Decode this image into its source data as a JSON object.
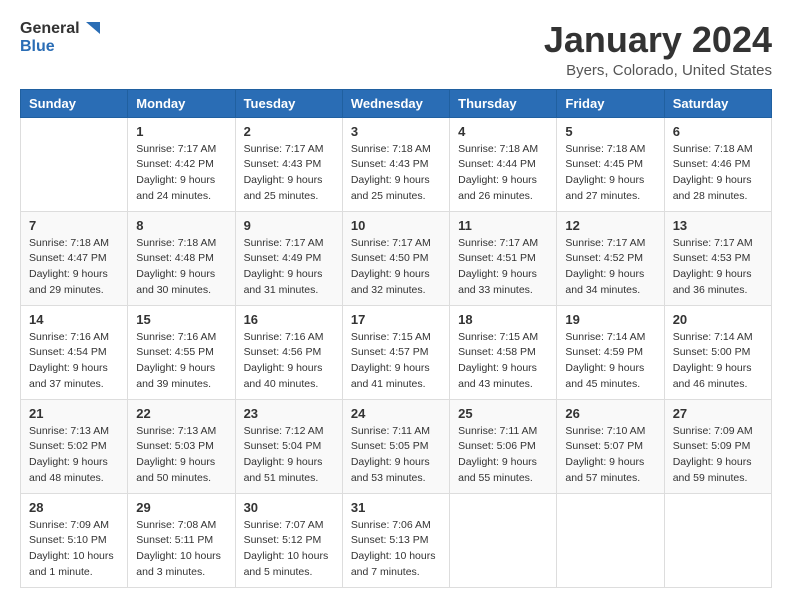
{
  "logo": {
    "general": "General",
    "blue": "Blue"
  },
  "header": {
    "month": "January 2024",
    "location": "Byers, Colorado, United States"
  },
  "weekdays": [
    "Sunday",
    "Monday",
    "Tuesday",
    "Wednesday",
    "Thursday",
    "Friday",
    "Saturday"
  ],
  "weeks": [
    [
      {
        "day": null
      },
      {
        "day": "1",
        "sunrise": "Sunrise: 7:17 AM",
        "sunset": "Sunset: 4:42 PM",
        "daylight": "Daylight: 9 hours and 24 minutes."
      },
      {
        "day": "2",
        "sunrise": "Sunrise: 7:17 AM",
        "sunset": "Sunset: 4:43 PM",
        "daylight": "Daylight: 9 hours and 25 minutes."
      },
      {
        "day": "3",
        "sunrise": "Sunrise: 7:18 AM",
        "sunset": "Sunset: 4:43 PM",
        "daylight": "Daylight: 9 hours and 25 minutes."
      },
      {
        "day": "4",
        "sunrise": "Sunrise: 7:18 AM",
        "sunset": "Sunset: 4:44 PM",
        "daylight": "Daylight: 9 hours and 26 minutes."
      },
      {
        "day": "5",
        "sunrise": "Sunrise: 7:18 AM",
        "sunset": "Sunset: 4:45 PM",
        "daylight": "Daylight: 9 hours and 27 minutes."
      },
      {
        "day": "6",
        "sunrise": "Sunrise: 7:18 AM",
        "sunset": "Sunset: 4:46 PM",
        "daylight": "Daylight: 9 hours and 28 minutes."
      }
    ],
    [
      {
        "day": "7",
        "sunrise": "Sunrise: 7:18 AM",
        "sunset": "Sunset: 4:47 PM",
        "daylight": "Daylight: 9 hours and 29 minutes."
      },
      {
        "day": "8",
        "sunrise": "Sunrise: 7:18 AM",
        "sunset": "Sunset: 4:48 PM",
        "daylight": "Daylight: 9 hours and 30 minutes."
      },
      {
        "day": "9",
        "sunrise": "Sunrise: 7:17 AM",
        "sunset": "Sunset: 4:49 PM",
        "daylight": "Daylight: 9 hours and 31 minutes."
      },
      {
        "day": "10",
        "sunrise": "Sunrise: 7:17 AM",
        "sunset": "Sunset: 4:50 PM",
        "daylight": "Daylight: 9 hours and 32 minutes."
      },
      {
        "day": "11",
        "sunrise": "Sunrise: 7:17 AM",
        "sunset": "Sunset: 4:51 PM",
        "daylight": "Daylight: 9 hours and 33 minutes."
      },
      {
        "day": "12",
        "sunrise": "Sunrise: 7:17 AM",
        "sunset": "Sunset: 4:52 PM",
        "daylight": "Daylight: 9 hours and 34 minutes."
      },
      {
        "day": "13",
        "sunrise": "Sunrise: 7:17 AM",
        "sunset": "Sunset: 4:53 PM",
        "daylight": "Daylight: 9 hours and 36 minutes."
      }
    ],
    [
      {
        "day": "14",
        "sunrise": "Sunrise: 7:16 AM",
        "sunset": "Sunset: 4:54 PM",
        "daylight": "Daylight: 9 hours and 37 minutes."
      },
      {
        "day": "15",
        "sunrise": "Sunrise: 7:16 AM",
        "sunset": "Sunset: 4:55 PM",
        "daylight": "Daylight: 9 hours and 39 minutes."
      },
      {
        "day": "16",
        "sunrise": "Sunrise: 7:16 AM",
        "sunset": "Sunset: 4:56 PM",
        "daylight": "Daylight: 9 hours and 40 minutes."
      },
      {
        "day": "17",
        "sunrise": "Sunrise: 7:15 AM",
        "sunset": "Sunset: 4:57 PM",
        "daylight": "Daylight: 9 hours and 41 minutes."
      },
      {
        "day": "18",
        "sunrise": "Sunrise: 7:15 AM",
        "sunset": "Sunset: 4:58 PM",
        "daylight": "Daylight: 9 hours and 43 minutes."
      },
      {
        "day": "19",
        "sunrise": "Sunrise: 7:14 AM",
        "sunset": "Sunset: 4:59 PM",
        "daylight": "Daylight: 9 hours and 45 minutes."
      },
      {
        "day": "20",
        "sunrise": "Sunrise: 7:14 AM",
        "sunset": "Sunset: 5:00 PM",
        "daylight": "Daylight: 9 hours and 46 minutes."
      }
    ],
    [
      {
        "day": "21",
        "sunrise": "Sunrise: 7:13 AM",
        "sunset": "Sunset: 5:02 PM",
        "daylight": "Daylight: 9 hours and 48 minutes."
      },
      {
        "day": "22",
        "sunrise": "Sunrise: 7:13 AM",
        "sunset": "Sunset: 5:03 PM",
        "daylight": "Daylight: 9 hours and 50 minutes."
      },
      {
        "day": "23",
        "sunrise": "Sunrise: 7:12 AM",
        "sunset": "Sunset: 5:04 PM",
        "daylight": "Daylight: 9 hours and 51 minutes."
      },
      {
        "day": "24",
        "sunrise": "Sunrise: 7:11 AM",
        "sunset": "Sunset: 5:05 PM",
        "daylight": "Daylight: 9 hours and 53 minutes."
      },
      {
        "day": "25",
        "sunrise": "Sunrise: 7:11 AM",
        "sunset": "Sunset: 5:06 PM",
        "daylight": "Daylight: 9 hours and 55 minutes."
      },
      {
        "day": "26",
        "sunrise": "Sunrise: 7:10 AM",
        "sunset": "Sunset: 5:07 PM",
        "daylight": "Daylight: 9 hours and 57 minutes."
      },
      {
        "day": "27",
        "sunrise": "Sunrise: 7:09 AM",
        "sunset": "Sunset: 5:09 PM",
        "daylight": "Daylight: 9 hours and 59 minutes."
      }
    ],
    [
      {
        "day": "28",
        "sunrise": "Sunrise: 7:09 AM",
        "sunset": "Sunset: 5:10 PM",
        "daylight": "Daylight: 10 hours and 1 minute."
      },
      {
        "day": "29",
        "sunrise": "Sunrise: 7:08 AM",
        "sunset": "Sunset: 5:11 PM",
        "daylight": "Daylight: 10 hours and 3 minutes."
      },
      {
        "day": "30",
        "sunrise": "Sunrise: 7:07 AM",
        "sunset": "Sunset: 5:12 PM",
        "daylight": "Daylight: 10 hours and 5 minutes."
      },
      {
        "day": "31",
        "sunrise": "Sunrise: 7:06 AM",
        "sunset": "Sunset: 5:13 PM",
        "daylight": "Daylight: 10 hours and 7 minutes."
      },
      {
        "day": null
      },
      {
        "day": null
      },
      {
        "day": null
      }
    ]
  ]
}
